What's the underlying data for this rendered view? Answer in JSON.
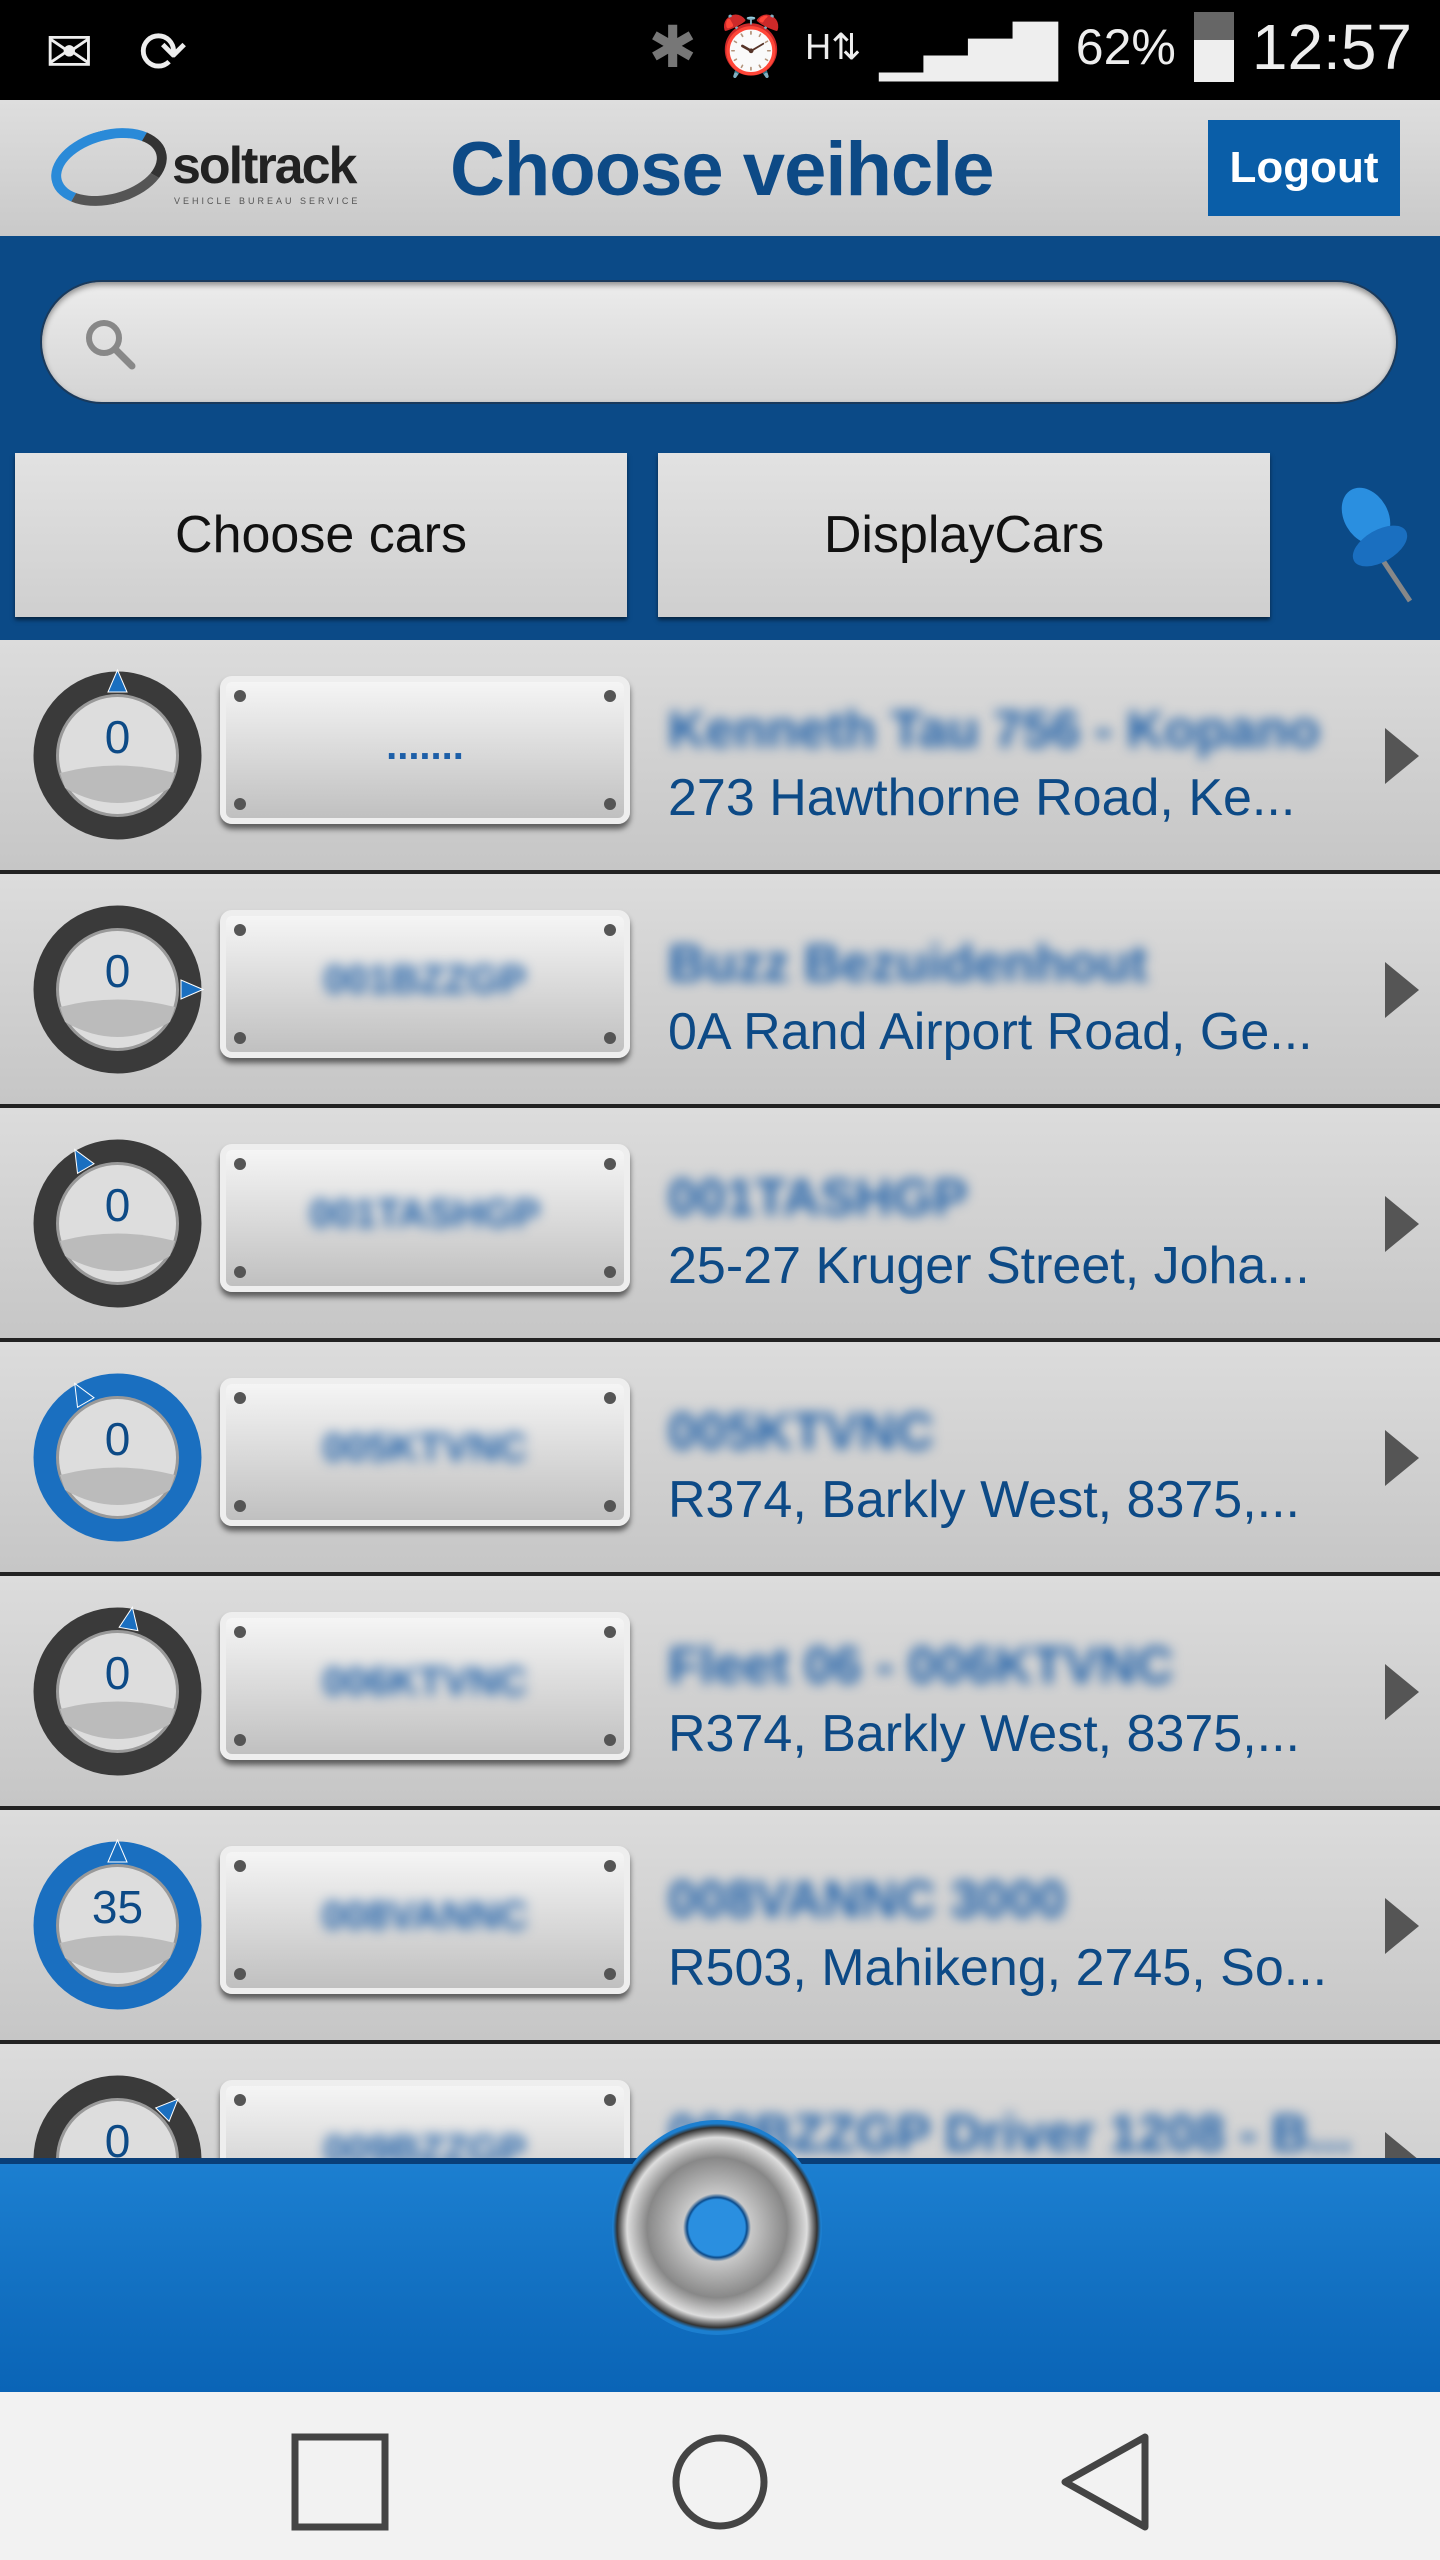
{
  "status_bar": {
    "battery": "62%",
    "time": "12:57",
    "icons": [
      "gmail-icon",
      "sync-icon",
      "bluetooth-icon",
      "alarm-icon",
      "hspa-data-icon",
      "signal-icon",
      "battery-icon"
    ]
  },
  "header": {
    "logo_text": "soltrack",
    "logo_subtext": "VEHICLE BUREAU SERVICE",
    "title": "Choose veihcle",
    "logout_label": "Logout"
  },
  "search": {
    "placeholder": "",
    "value": ""
  },
  "buttons": {
    "choose_cars": "Choose cars",
    "display_cars": "DisplayCars"
  },
  "colors": {
    "brand_blue": "#0b4a87",
    "text_blue": "#0d4a86",
    "active_ring": "#1a6fc0",
    "inactive_ring": "#3a3a3a"
  },
  "vehicles": [
    {
      "speed": "0",
      "plate": ".......",
      "plate_blurred": false,
      "name": "Kenneth Tau 756 - Kopano",
      "address": "273 Hawthorne Road, Ke...",
      "heading": 0,
      "active": false
    },
    {
      "speed": "0",
      "plate": "001BZZGP",
      "plate_blurred": true,
      "name": "Buzz Bezuidenhout",
      "address": "0A Rand Airport Road, Ge...",
      "heading": 90,
      "active": false
    },
    {
      "speed": "0",
      "plate": "001TASHGP",
      "plate_blurred": true,
      "name": "001TASHGP",
      "address": "25-27 Kruger Street, Joha...",
      "heading": -30,
      "active": false
    },
    {
      "speed": "0",
      "plate": "005KTVNC",
      "plate_blurred": true,
      "name": "005KTVNC",
      "address": "R374, Barkly West, 8375,...",
      "heading": -30,
      "active": true
    },
    {
      "speed": "0",
      "plate": "006KTVNC",
      "plate_blurred": true,
      "name": "Fleet 06 - 006KTVNC",
      "address": "R374, Barkly West, 8375,...",
      "heading": 10,
      "active": false
    },
    {
      "speed": "35",
      "plate": "008VANNC",
      "plate_blurred": true,
      "name": "008VANNC 3000",
      "address": "R503, Mahikeng, 2745, So...",
      "heading": 0,
      "active": true
    },
    {
      "speed": "0",
      "plate": "009BZZGP",
      "plate_blurred": true,
      "name": "009BZZGP Driver 1208 - B...",
      "address": "",
      "heading": 45,
      "active": false
    }
  ]
}
